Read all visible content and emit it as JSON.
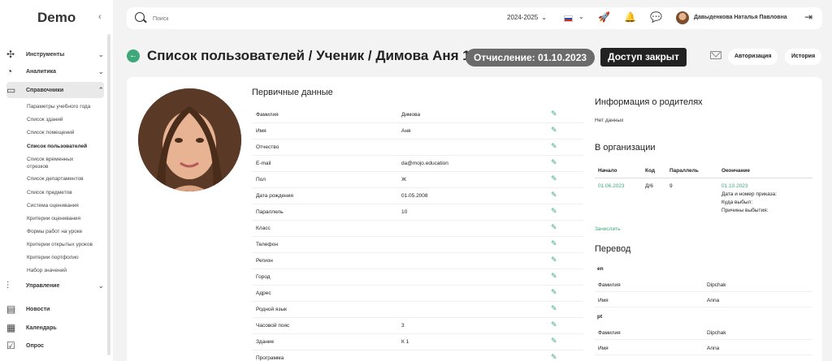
{
  "app": {
    "logo": "Demo"
  },
  "sidebar": {
    "sections": [
      {
        "label": "Инструменты",
        "icon": "puzzle-icon"
      },
      {
        "label": "Аналитика",
        "icon": "chart-icon"
      },
      {
        "label": "Справочники",
        "icon": "book-icon"
      }
    ],
    "subitems": [
      "Параметры учебного года",
      "Список зданий",
      "Список помещений",
      "Список пользователей",
      "Список временных отрезков",
      "Список департаментов",
      "Список предметов",
      "Система оценивания",
      "Критерии оценивания",
      "Формы работ на уроке",
      "Критерии открытых уроков",
      "Критерии портфолио",
      "Набор значений"
    ],
    "bottom": [
      {
        "label": "Управление",
        "icon": "sliders-icon"
      },
      {
        "label": "Новости",
        "icon": "news-icon"
      },
      {
        "label": "Календарь",
        "icon": "calendar-icon"
      },
      {
        "label": "Опрос",
        "icon": "survey-icon"
      }
    ]
  },
  "topbar": {
    "search_placeholder": "Поиск",
    "year": "2024-2025",
    "user_name": "Давыденкова Наталья Павловна"
  },
  "header": {
    "title": "Список пользователей / Ученик / Димова Аня 10",
    "expulsion_badge": "Отчисление: 01.10.2023",
    "access_badge": "Доступ закрыт",
    "auth_button": "Авторизация",
    "history_button": "История"
  },
  "primary": {
    "title": "Первичные данные",
    "fields": [
      {
        "label": "Фамилия",
        "value": "Димова"
      },
      {
        "label": "Имя",
        "value": "Аня"
      },
      {
        "label": "Отчество",
        "value": ""
      },
      {
        "label": "E-mail",
        "value": "da@mojo.education"
      },
      {
        "label": "Пол",
        "value": "Ж"
      },
      {
        "label": "Дата рождения",
        "value": "01.05.2008"
      },
      {
        "label": "Параллель",
        "value": "10"
      },
      {
        "label": "Класс",
        "value": ""
      },
      {
        "label": "Телефон",
        "value": ""
      },
      {
        "label": "Регион",
        "value": ""
      },
      {
        "label": "Город",
        "value": ""
      },
      {
        "label": "Адрес",
        "value": ""
      },
      {
        "label": "Родной язык",
        "value": ""
      },
      {
        "label": "Часовой пояс",
        "value": "3"
      },
      {
        "label": "Здание",
        "value": "К 1"
      },
      {
        "label": "Программа",
        "value": ""
      }
    ]
  },
  "parents": {
    "title": "Информация о родителях",
    "empty": "Нет данных"
  },
  "org": {
    "title": "В организации",
    "headers": [
      "Начало",
      "Код",
      "Параллель",
      "Окончание"
    ],
    "row": {
      "start": "01.06.2023",
      "code": "Д/6",
      "parallel": "9",
      "end": "01.10.2023",
      "note1": "Дата и номер приказа:",
      "note2": "Куда выбыл:",
      "note3": "Причины выбытия:"
    },
    "enroll_link": "Зачислить"
  },
  "transfer": {
    "title": "Перевод",
    "groups": [
      {
        "lang": "en",
        "rows": [
          {
            "key": "Фамилия",
            "value": "Dipchak"
          },
          {
            "key": "Имя",
            "value": "Anna"
          }
        ]
      },
      {
        "lang": "pt",
        "rows": [
          {
            "key": "Фамилия",
            "value": "Dipchak"
          },
          {
            "key": "Имя",
            "value": "Anna"
          }
        ]
      }
    ]
  }
}
